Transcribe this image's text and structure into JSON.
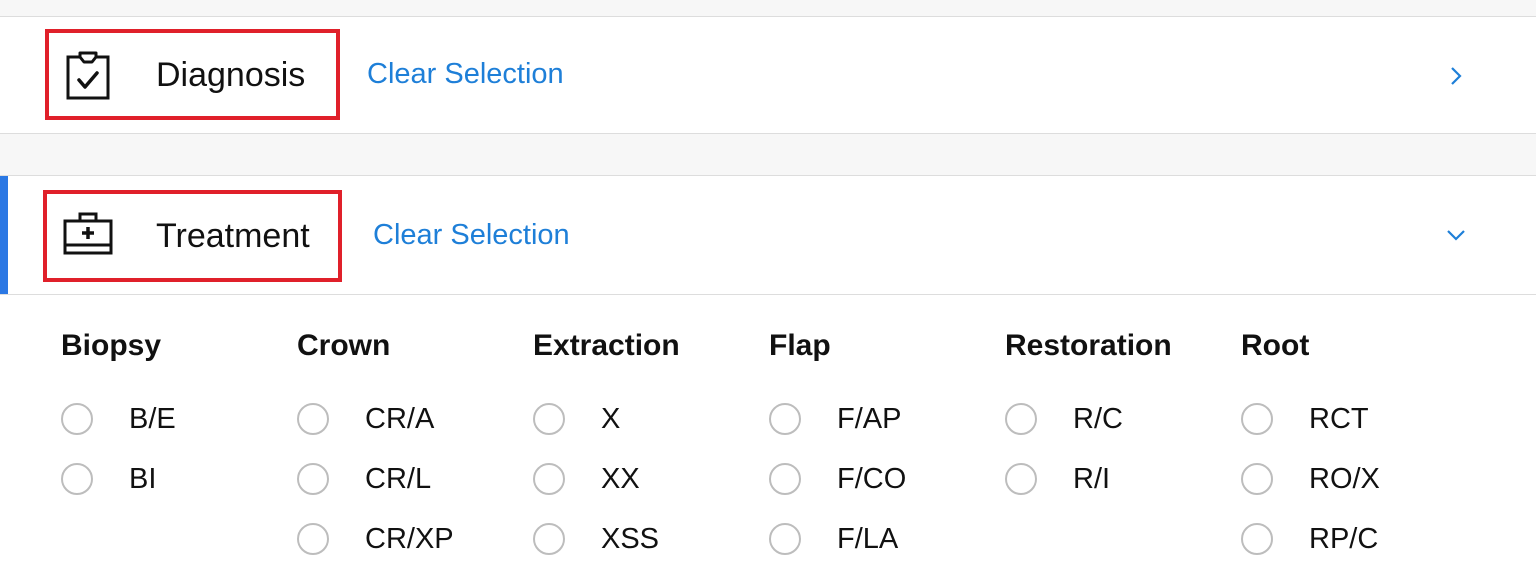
{
  "sections": {
    "diagnosis": {
      "title": "Diagnosis",
      "clear_label": "Clear Selection",
      "icon": "clipboard-check-icon",
      "expanded": false
    },
    "treatment": {
      "title": "Treatment",
      "clear_label": "Clear Selection",
      "icon": "medical-kit-icon",
      "expanded": true
    }
  },
  "categories": [
    {
      "title": "Biopsy",
      "options": [
        "B/E",
        "BI"
      ]
    },
    {
      "title": "Crown",
      "options": [
        "CR/A",
        "CR/L",
        "CR/XP"
      ]
    },
    {
      "title": "Extraction",
      "options": [
        "X",
        "XX",
        "XSS"
      ]
    },
    {
      "title": "Flap",
      "options": [
        "F/AP",
        "F/CO",
        "F/LA"
      ]
    },
    {
      "title": "Restoration",
      "options": [
        "R/C",
        "R/I"
      ]
    },
    {
      "title": "Root",
      "options": [
        "RCT",
        "RO/X",
        "RP/C"
      ]
    }
  ],
  "colors": {
    "link": "#1e7fd8",
    "accent": "#2b78e4",
    "highlight": "#e0202a",
    "chevron": "#1e7fd8"
  }
}
